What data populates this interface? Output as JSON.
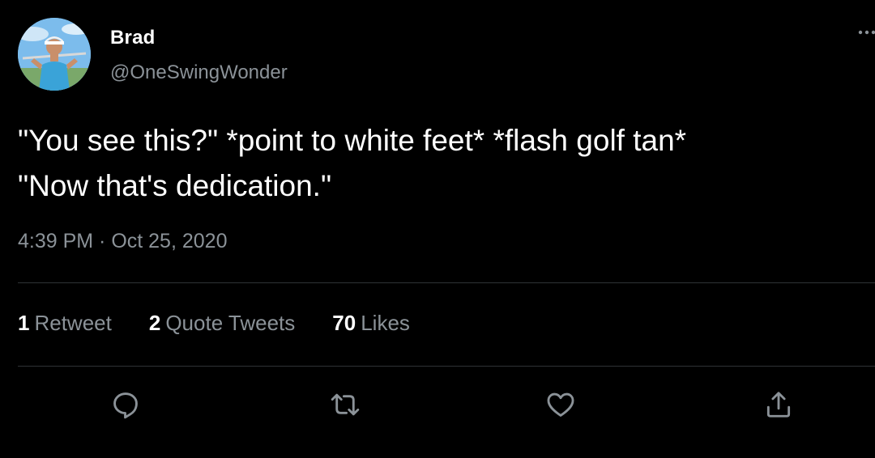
{
  "user": {
    "name": "Brad",
    "handle": "@OneSwingWonder"
  },
  "tweet": {
    "text_line1": "\"You see this?\" *point to white feet* *flash golf tan*",
    "text_line2": "\"Now that's dedication.\"",
    "timestamp": "4:39 PM · Oct 25, 2020"
  },
  "stats": {
    "retweets": {
      "count": "1",
      "label": "Retweet"
    },
    "quotes": {
      "count": "2",
      "label": "Quote Tweets"
    },
    "likes": {
      "count": "70",
      "label": "Likes"
    }
  },
  "actions": [
    "reply-icon",
    "retweet-icon",
    "like-icon",
    "share-icon"
  ],
  "colors": {
    "background": "#000000",
    "primary_text": "#ffffff",
    "secondary_text": "#8b9298",
    "divider": "#2f3336",
    "icon": "#8b9298"
  }
}
